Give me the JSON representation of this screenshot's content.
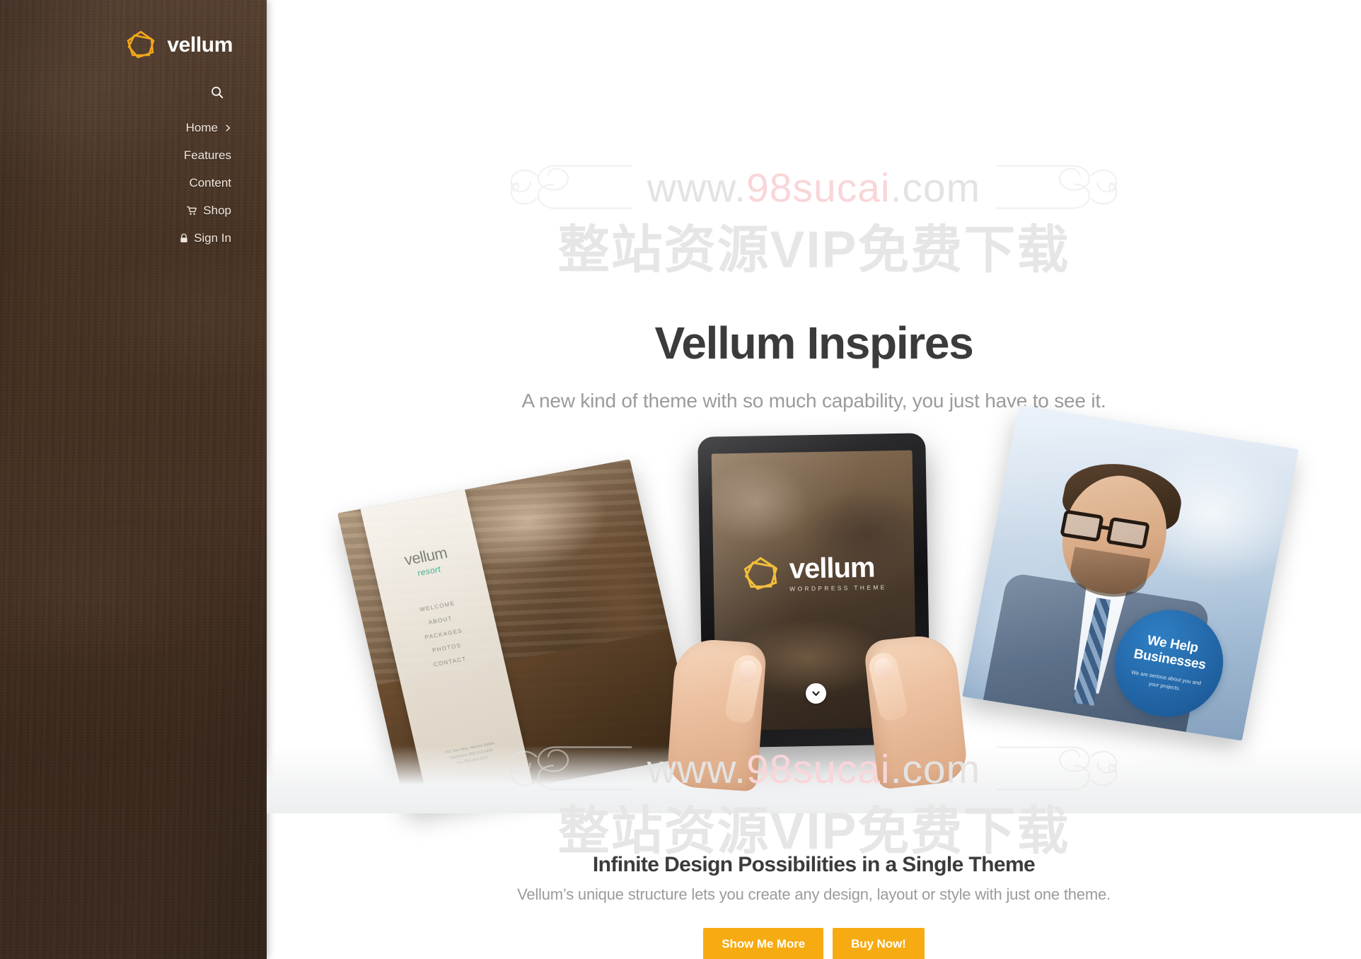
{
  "sidebar": {
    "brand": {
      "name": "vellum",
      "logo_icon": "pentagon-logo-icon",
      "accent": "#F2A71B"
    },
    "search": {
      "icon": "search-icon",
      "label": "Search"
    },
    "nav": [
      {
        "label": "Home",
        "icon": null,
        "chevron": "›"
      },
      {
        "label": "Features",
        "icon": null,
        "chevron": ""
      },
      {
        "label": "Content",
        "icon": null,
        "chevron": ""
      },
      {
        "label": "Shop",
        "icon": "cart-icon",
        "chevron": ""
      },
      {
        "label": "Sign In",
        "icon": "lock-icon",
        "chevron": ""
      }
    ],
    "background_color": "#4A3423"
  },
  "hero": {
    "title": "Vellum Inspires",
    "subtitle": "A new kind of theme with so much capability, you just have to see it.",
    "title_color": "#3B3B3D",
    "subtitle_color": "#9B9B9B"
  },
  "watermark": {
    "url_prefix": "www.",
    "url_highlight": "98sucai",
    "url_suffix": ".com",
    "chinese": "整站资源VIP免费下载",
    "highlight_color": "#F9D6D8",
    "base_color": "#E3E3E3"
  },
  "showcase": {
    "tablet": {
      "brand": "vellum",
      "tagline": "WORDPRESS THEME",
      "scroll_icon": "chevron-down-circle-icon",
      "logo_icon": "pentagon-logo-icon"
    },
    "left_card": {
      "brand": "vellum",
      "brand_sub": "resort",
      "nav": [
        "WELCOME",
        "ABOUT",
        "PACKAGES",
        "PHOTOS",
        "CONTACT"
      ],
      "address": "202 Sea Way, Mexico 54984\nTelephone 555-012-3456\nFax 555-684-3241"
    },
    "right_card": {
      "badge_title": "We Help Businesses",
      "badge_text": "We are serious about you and your projects.",
      "badge_color": "#1F5F9E"
    }
  },
  "footer": {
    "title": "Infinite Design Possibilities in a Single Theme",
    "subtitle": "Vellum’s unique structure lets you create any design, layout or style with just one theme.",
    "buttons": [
      {
        "label": "Show Me More",
        "color": "#F7AB12"
      },
      {
        "label": "Buy Now!",
        "color": "#F7AB12"
      }
    ]
  }
}
